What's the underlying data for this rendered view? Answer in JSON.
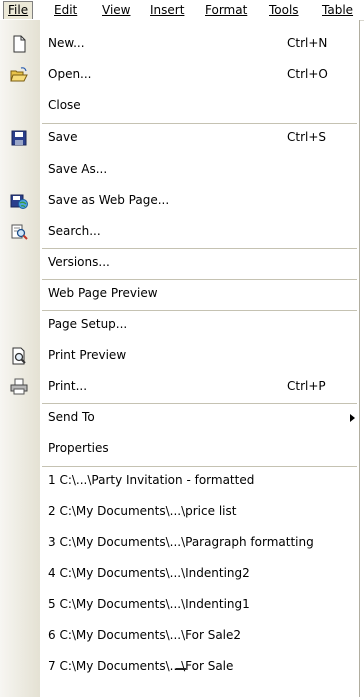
{
  "menubar": {
    "items": [
      "File",
      "Edit",
      "View",
      "Insert",
      "Format",
      "Tools",
      "Table"
    ]
  },
  "menu": {
    "new": {
      "label": "New...",
      "shortcut": "Ctrl+N"
    },
    "open": {
      "label": "Open...",
      "shortcut": "Ctrl+O"
    },
    "close": {
      "label": "Close"
    },
    "save": {
      "label": "Save",
      "shortcut": "Ctrl+S"
    },
    "save_as": {
      "label": "Save As..."
    },
    "save_web": {
      "label": "Save as Web Page..."
    },
    "search": {
      "label": "Search..."
    },
    "versions": {
      "label": "Versions..."
    },
    "web_preview": {
      "label": "Web Page Preview"
    },
    "page_setup": {
      "label": "Page Setup..."
    },
    "print_preview": {
      "label": "Print Preview"
    },
    "print": {
      "label": "Print...",
      "shortcut": "Ctrl+P"
    },
    "send_to": {
      "label": "Send To"
    },
    "properties": {
      "label": "Properties"
    },
    "recent": [
      "1 C:\\...\\Party Invitation - formatted",
      "2 C:\\My Documents\\...\\price list",
      "3 C:\\My Documents\\...\\Paragraph formatting",
      "4 C:\\My Documents\\...\\Indenting2",
      "5 C:\\My Documents\\...\\Indenting1",
      "6 C:\\My Documents\\...\\For Sale2",
      "7 C:\\My Documents\\...\\For Sale"
    ]
  }
}
